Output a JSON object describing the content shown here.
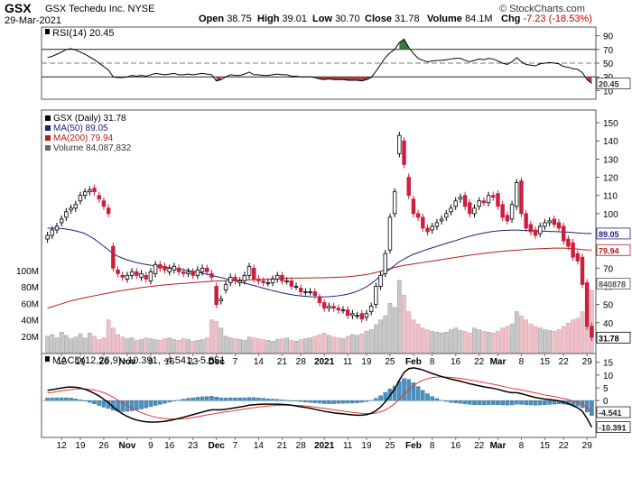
{
  "header": {
    "symbol": "GSX",
    "company": "GSX Techedu Inc.",
    "exchange": "NYSE",
    "date": "29-Mar-2021",
    "open_label": "Open",
    "open": "38.75",
    "high_label": "High",
    "high": "39.01",
    "low_label": "Low",
    "low": "30.70",
    "close_label": "Close",
    "close": "31.78",
    "volume_label": "Volume",
    "volume": "84.1M",
    "chg_label": "Chg",
    "chg": "-7.23 (-18.53%)",
    "copyright": "© StockCharts.com",
    "chg_color": "#cc0000"
  },
  "chart_data": {
    "type": "candlestick",
    "symbol": "GSX",
    "x_labels": [
      "12",
      "19",
      "26",
      "Nov",
      "9",
      "16",
      "23",
      "Dec",
      "7",
      "14",
      "21",
      "28",
      "2021",
      "11",
      "19",
      "25",
      "Feb",
      "8",
      "16",
      "22",
      "Mar",
      "8",
      "15",
      "22",
      "29"
    ],
    "price_axis": {
      "ticks": [
        150,
        140,
        130,
        120,
        110,
        100,
        90,
        80,
        70,
        60,
        50,
        40
      ],
      "min": 25,
      "max": 155
    },
    "volume_axis": {
      "ticks": [
        "100M",
        "80M",
        "60M",
        "40M",
        "20M"
      ]
    },
    "price_legend": [
      "GSX (Daily) 31.78",
      "MA(50) 89.05",
      "MA(200) 79.94",
      "Volume 84,087,832"
    ],
    "price_tags": [
      {
        "label": "89.05",
        "value": 89.05,
        "color": "#1a237e"
      },
      {
        "label": "79.94",
        "value": 79.94,
        "color": "#b71c1c"
      },
      {
        "label": "840878",
        "value": 84.1,
        "color": "#555555"
      },
      {
        "label": "31.78",
        "value": 31.78,
        "color": "#000000"
      }
    ],
    "closes": [
      88,
      91,
      93,
      97,
      101,
      103,
      105,
      110,
      112,
      113,
      112,
      108,
      104,
      100,
      70,
      67,
      65,
      66,
      68,
      66,
      67,
      64,
      68,
      72,
      70,
      69,
      70,
      71,
      68,
      67,
      68,
      66,
      69,
      70,
      68,
      65,
      50,
      53,
      61,
      65,
      63,
      63,
      66,
      71,
      64,
      63,
      62,
      62,
      64,
      66,
      63,
      63,
      60,
      60,
      57,
      57,
      57,
      55,
      51,
      48,
      49,
      48,
      47,
      47,
      44,
      45,
      44,
      42,
      45,
      49,
      60,
      66,
      78,
      98,
      112,
      143,
      127,
      110,
      100,
      98,
      92,
      90,
      93,
      95,
      97,
      100,
      103,
      107,
      109,
      104,
      100,
      103,
      107,
      106,
      110,
      109,
      104,
      98,
      96,
      105,
      117,
      100,
      92,
      90,
      88,
      93,
      95,
      96,
      94,
      92,
      85,
      82,
      76,
      74,
      61,
      38,
      32
    ],
    "opens": [
      86,
      88,
      91,
      95,
      98,
      102,
      103,
      107,
      110,
      112,
      114,
      110,
      107,
      103,
      82,
      69,
      66,
      64,
      66,
      68,
      65,
      66,
      63,
      67,
      72,
      71,
      68,
      69,
      70,
      68,
      67,
      68,
      66,
      68,
      70,
      67,
      60,
      52,
      58,
      62,
      65,
      62,
      63,
      66,
      70,
      64,
      63,
      62,
      62,
      64,
      66,
      63,
      63,
      60,
      59,
      57,
      57,
      57,
      54,
      51,
      48,
      49,
      48,
      47,
      47,
      44,
      44,
      45,
      43,
      46,
      50,
      60,
      67,
      80,
      100,
      133,
      140,
      120,
      108,
      100,
      98,
      92,
      91,
      93,
      96,
      98,
      101,
      104,
      108,
      110,
      106,
      100,
      104,
      107,
      106,
      110,
      111,
      105,
      99,
      97,
      104,
      118,
      100,
      94,
      91,
      89,
      93,
      95,
      97,
      95,
      93,
      86,
      84,
      78,
      76,
      62,
      38
    ],
    "ma50": [
      92,
      92,
      92,
      91.8,
      91.5,
      91,
      90.5,
      89.8,
      89,
      87.5,
      86,
      84,
      82,
      80,
      78,
      76.5,
      75.5,
      74.5,
      73.8,
      73,
      72.5,
      72,
      71.6,
      71.2,
      70.8,
      70.5,
      70.2,
      69.8,
      69.5,
      69.1,
      68.7,
      68.3,
      67.8,
      67.2,
      66.6,
      66,
      65.4,
      64.8,
      64.2,
      63.6,
      63,
      62.4,
      61.8,
      61.1,
      60.4,
      59.7,
      59,
      58.3,
      57.6,
      57,
      56.4,
      55.9,
      55.4,
      55,
      54.7,
      54.5,
      54.3,
      54.2,
      54.2,
      54.2,
      54.3,
      54.5,
      54.8,
      55.2,
      55.7,
      56.4,
      57.3,
      58.4,
      59.8,
      61.5,
      63.5,
      65.5,
      67.5,
      69.5,
      71.5,
      73.5,
      75,
      76.4,
      77.6,
      78.6,
      79.5,
      80.4,
      81.2,
      82,
      82.8,
      83.6,
      84.4,
      85.2,
      86,
      86.8,
      87.5,
      88.2,
      88.8,
      89.3,
      89.8,
      90.2,
      90.5,
      90.7,
      90.8,
      90.9,
      90.9,
      90.8,
      90.7,
      90.6,
      90.5,
      90.4,
      90.3,
      90.2,
      90.1,
      90,
      89.9,
      89.8,
      89.6,
      89.4,
      89.2,
      89.1,
      89.05
    ],
    "ma200": [
      48,
      48.8,
      49.6,
      50.4,
      51.2,
      52,
      52.6,
      53.2,
      53.8,
      54.3,
      54.8,
      55.3,
      55.8,
      56.3,
      56.8,
      57.3,
      57.7,
      58.1,
      58.5,
      58.9,
      59.3,
      59.6,
      59.9,
      60.2,
      60.5,
      60.8,
      61,
      61.2,
      61.4,
      61.6,
      61.8,
      62,
      62.2,
      62.4,
      62.6,
      62.8,
      62.9,
      63,
      63.1,
      63.2,
      63.3,
      63.4,
      63.5,
      63.6,
      63.7,
      63.8,
      63.9,
      64,
      64.1,
      64.2,
      64.3,
      64.4,
      64.5,
      64.5,
      64.6,
      64.6,
      64.6,
      64.7,
      64.7,
      64.7,
      64.8,
      64.9,
      65,
      65.1,
      65.3,
      65.5,
      65.8,
      66.1,
      66.5,
      67,
      67.6,
      68.3,
      69,
      69.7,
      70.4,
      71,
      71.5,
      71.9,
      72.3,
      72.7,
      73.1,
      73.5,
      73.9,
      74.3,
      74.7,
      75.1,
      75.5,
      75.9,
      76.3,
      76.7,
      77.1,
      77.5,
      77.8,
      78.1,
      78.4,
      78.7,
      79,
      79.3,
      79.5,
      79.7,
      79.9,
      80.1,
      80.3,
      80.5,
      80.6,
      80.7,
      80.8,
      80.9,
      81,
      81,
      81,
      80.9,
      80.7,
      80.5,
      80.2,
      80,
      79.94
    ],
    "volume": [
      20,
      22,
      18,
      25,
      21,
      17,
      19,
      23,
      18,
      24,
      20,
      16,
      18,
      40,
      30,
      22,
      19,
      17,
      18,
      15,
      16,
      18,
      17,
      16,
      15,
      17,
      18,
      16,
      15,
      17,
      16,
      14,
      15,
      16,
      18,
      40,
      38,
      30,
      20,
      18,
      17,
      16,
      15,
      19,
      18,
      17,
      16,
      15,
      14,
      16,
      17,
      18,
      15,
      14,
      16,
      17,
      18,
      20,
      22,
      24,
      21,
      19,
      18,
      17,
      20,
      22,
      21,
      23,
      26,
      28,
      34,
      40,
      45,
      60,
      55,
      88,
      70,
      50,
      40,
      35,
      30,
      28,
      26,
      25,
      24,
      25,
      28,
      30,
      27,
      26,
      24,
      30,
      28,
      26,
      25,
      24,
      26,
      30,
      32,
      35,
      50,
      45,
      40,
      35,
      32,
      30,
      28,
      27,
      26,
      28,
      32,
      36,
      40,
      42,
      50,
      84.1,
      76
    ],
    "rsi": {
      "label": "RSI(14) 20.45",
      "value": 20.45,
      "ticks": [
        90,
        70,
        50,
        30,
        10
      ],
      "last_tag": "20.45",
      "values": [
        58,
        60,
        63,
        66,
        70,
        71,
        69,
        66,
        63,
        59,
        55,
        50,
        45,
        40,
        30,
        29,
        29,
        30,
        32,
        31,
        32,
        31,
        33,
        35,
        34,
        33,
        34,
        35,
        33,
        33,
        34,
        33,
        34,
        35,
        34,
        33,
        24,
        26,
        30,
        33,
        32,
        32,
        34,
        37,
        33,
        33,
        32,
        32,
        33,
        34,
        33,
        33,
        31,
        31,
        30,
        30,
        30,
        29,
        27,
        26,
        27,
        26,
        26,
        26,
        25,
        25,
        25,
        24,
        26,
        29,
        38,
        48,
        58,
        65,
        70,
        80,
        85,
        73,
        64,
        57,
        54,
        52,
        53,
        54,
        54,
        55,
        56,
        57,
        57,
        54,
        52,
        54,
        56,
        55,
        57,
        56,
        53,
        50,
        48,
        52,
        58,
        52,
        48,
        47,
        46,
        49,
        50,
        51,
        50,
        49,
        45,
        44,
        42,
        41,
        36,
        26,
        20.45
      ]
    },
    "macd": {
      "label": "MACD(12,26,9) -10.391, -4.541, -5.851",
      "macd_value": -10.391,
      "signal_value": -4.541,
      "hist_value": -5.851,
      "ticks": [
        15,
        10,
        5,
        0,
        -5,
        -10
      ],
      "tags": [
        {
          "label": "-4.541",
          "value": -4.541
        },
        {
          "label": "-10.391",
          "value": -10.391
        }
      ],
      "macd": [
        4,
        4.3,
        4.6,
        4.9,
        5.2,
        5.3,
        5.2,
        4.9,
        4.4,
        3.7,
        2.8,
        1.8,
        0.5,
        -0.8,
        -2.5,
        -4,
        -5.2,
        -6.2,
        -7,
        -7.6,
        -8,
        -8.3,
        -8.4,
        -8.4,
        -8.3,
        -8.1,
        -7.8,
        -7.4,
        -7,
        -6.5,
        -6,
        -5.5,
        -5,
        -4.5,
        -4,
        -3.6,
        -3.6,
        -3.6,
        -3.4,
        -3.1,
        -2.8,
        -2.5,
        -2.2,
        -1.8,
        -1.6,
        -1.5,
        -1.4,
        -1.4,
        -1.4,
        -1.4,
        -1.5,
        -1.6,
        -1.8,
        -2.1,
        -2.4,
        -2.7,
        -3,
        -3.4,
        -3.8,
        -4.2,
        -4.5,
        -4.8,
        -5,
        -5.2,
        -5.4,
        -5.6,
        -5.7,
        -5.7,
        -5.5,
        -5,
        -4,
        -2.5,
        -0.5,
        2,
        4.5,
        8,
        11,
        12.5,
        12.8,
        12.5,
        12,
        11.3,
        10.6,
        10,
        9.4,
        8.9,
        8.4,
        8,
        7.6,
        7.1,
        6.6,
        6.2,
        5.8,
        5.4,
        5.1,
        4.8,
        4.4,
        3.9,
        3.4,
        3.1,
        3.1,
        2.7,
        2.2,
        1.7,
        1.2,
        0.9,
        0.6,
        0.4,
        0.2,
        -0.1,
        -0.6,
        -1.2,
        -2,
        -2.8,
        -4.2,
        -7,
        -10.391
      ],
      "signal": [
        3,
        3.2,
        3.5,
        3.8,
        4.1,
        4.3,
        4.5,
        4.6,
        4.6,
        4.4,
        4.1,
        3.7,
        3.1,
        2.3,
        1.3,
        0.2,
        -0.9,
        -2,
        -3,
        -3.9,
        -4.7,
        -5.4,
        -6,
        -6.5,
        -6.8,
        -7,
        -7.2,
        -7.2,
        -7.2,
        -7.1,
        -6.9,
        -6.6,
        -6.3,
        -6,
        -5.6,
        -5.3,
        -5,
        -4.7,
        -4.4,
        -4.2,
        -3.9,
        -3.6,
        -3.3,
        -3,
        -2.8,
        -2.5,
        -2.3,
        -2.1,
        -2,
        -1.9,
        -1.8,
        -1.8,
        -1.8,
        -1.9,
        -2,
        -2.1,
        -2.3,
        -2.5,
        -2.8,
        -3,
        -3.3,
        -3.6,
        -3.9,
        -4.1,
        -4.4,
        -4.6,
        -4.8,
        -5,
        -5.1,
        -5.1,
        -4.9,
        -4.4,
        -3.7,
        -2.6,
        -1.2,
        0.5,
        2.4,
        4.2,
        5.8,
        7,
        8,
        8.6,
        9,
        9.2,
        9.3,
        9.2,
        9.1,
        8.9,
        8.7,
        8.4,
        8.1,
        7.8,
        7.4,
        7.1,
        6.7,
        6.4,
        6,
        5.6,
        5.2,
        4.8,
        4.5,
        4.2,
        3.8,
        3.4,
        3,
        2.6,
        2.2,
        1.9,
        1.6,
        1.2,
        0.8,
        0.4,
        -0.1,
        -0.7,
        -1.4,
        -2.5,
        -4.541
      ]
    }
  }
}
